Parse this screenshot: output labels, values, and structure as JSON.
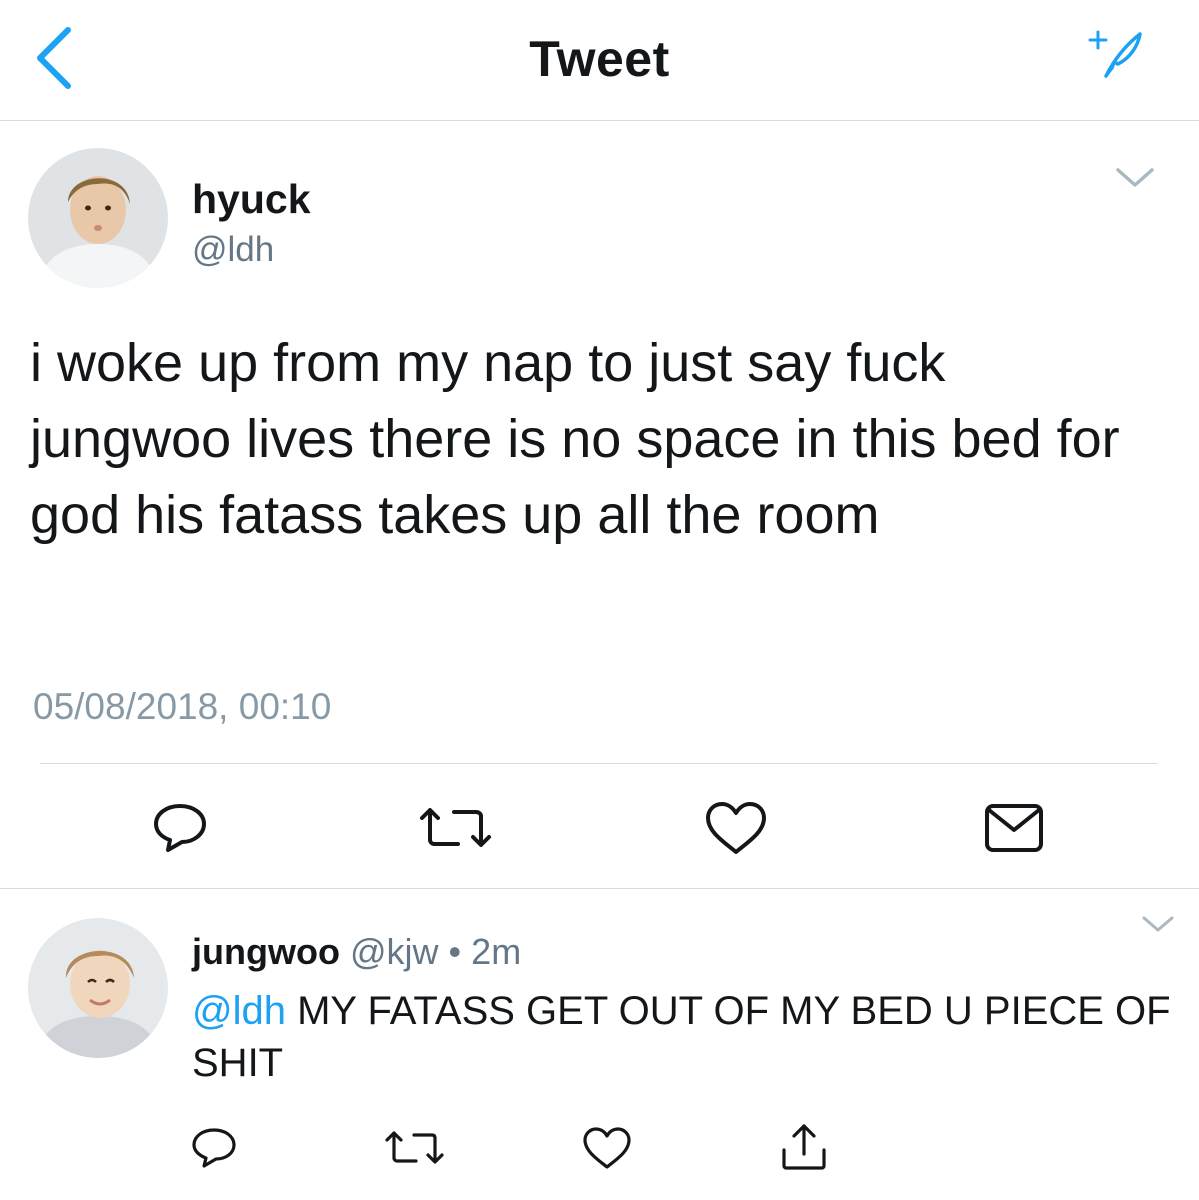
{
  "header": {
    "title": "Tweet",
    "back_icon": "chevron-left-icon",
    "compose_icon": "compose-quill-icon",
    "accent_color": "#1da1f2"
  },
  "tweet": {
    "author_name": "hyuck",
    "author_handle": "@ldh",
    "text": "i woke up from my nap to just say fuck jungwoo lives there is no space in this bed for god his fatass takes up all the room",
    "timestamp": "05/08/2018, 00:10",
    "actions": [
      "reply-icon",
      "retweet-icon",
      "like-icon",
      "direct-message-icon"
    ]
  },
  "reply": {
    "author_name": "jungwoo",
    "author_handle": "@kjw",
    "separator": "•",
    "time": "2m",
    "mention": "@ldh",
    "text": " MY FATASS GET OUT OF MY BED U PIECE OF SHIT",
    "actions": [
      "reply-icon",
      "retweet-icon",
      "like-icon",
      "share-icon"
    ]
  },
  "colors": {
    "text": "#14171a",
    "secondary": "#657786",
    "timestamp": "#8899a6",
    "divider": "#d6dbe0",
    "link": "#1da1f2"
  }
}
